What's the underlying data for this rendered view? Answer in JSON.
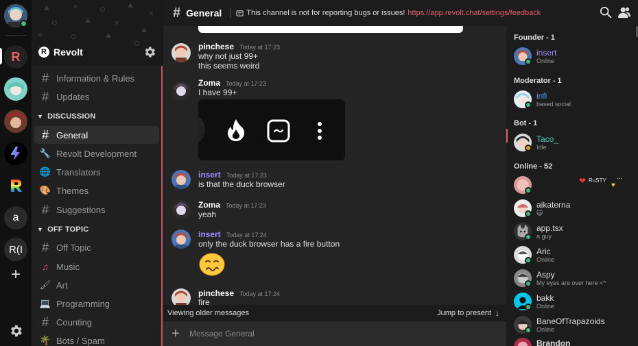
{
  "servers": {
    "home_label": "",
    "revolt_initial": "R",
    "letter_a": "a",
    "letter_ri": "R(I",
    "add_label": "+"
  },
  "server": {
    "name": "Revolt",
    "logo_letter": "R"
  },
  "channels": {
    "top": [
      {
        "label": "Information & Rules",
        "icon": "hash-icon"
      },
      {
        "label": "Updates",
        "icon": "hash-icon"
      }
    ],
    "cat_discussion": "DISCUSSION",
    "discussion": [
      {
        "label": "General",
        "icon": "hash-icon"
      },
      {
        "label": "Revolt Development",
        "icon": "wrench-icon"
      },
      {
        "label": "Translators",
        "icon": "globe-icon"
      },
      {
        "label": "Themes",
        "icon": "palette-icon"
      },
      {
        "label": "Suggestions",
        "icon": "hash-icon"
      }
    ],
    "cat_offtopic": "OFF TOPIC",
    "offtopic": [
      {
        "label": "Off Topic",
        "icon": "hash-icon"
      },
      {
        "label": "Music",
        "icon": "music-note-icon"
      },
      {
        "label": "Art",
        "icon": "paintbrush-icon"
      },
      {
        "label": "Programming",
        "icon": "laptop-icon"
      },
      {
        "label": "Counting",
        "icon": "hash-icon"
      },
      {
        "label": "Bots / Spam",
        "icon": "palm-tree-icon"
      }
    ]
  },
  "header": {
    "hash": "#",
    "title": "General",
    "topic_text": "This channel is not for reporting bugs or issues!",
    "topic_link": "https://app.revolt.chat/settings/feedback"
  },
  "messages": [
    {
      "author": "pinchese",
      "time": "Today at 17:23",
      "lines": [
        "why not just 99+",
        "this seems weird"
      ]
    },
    {
      "author": "Zoma",
      "time": "Today at 17:23",
      "lines": [
        "I have 99+"
      ]
    },
    {
      "author": "insert",
      "time": "Today at 17:23",
      "lines": [
        "is that the duck browser"
      ]
    },
    {
      "author": "Zoma",
      "time": "Today at 17:23",
      "lines": [
        "yeah"
      ]
    },
    {
      "author": "insert",
      "time": "Today at 17:24",
      "lines": [
        "only the duck browser has a fire button"
      ]
    },
    {
      "author": "pinchese",
      "time": "Today at 17:24",
      "lines": [
        "fire"
      ]
    }
  ],
  "older_bar": {
    "label": "Viewing older messages",
    "jump": "Jump to present"
  },
  "composer": {
    "placeholder": "Message General",
    "plus": "+"
  },
  "members": {
    "founder_label": "Founder - 1",
    "moderator_label": "Moderator - 1",
    "bot_label": "Bot - 1",
    "online_label": "Online - 52",
    "founder": {
      "name": "insert",
      "status": "Online"
    },
    "moderator": {
      "name": "infi",
      "status": "based.social"
    },
    "bot": {
      "name": "Taco_",
      "status": "Idle"
    },
    "online": [
      {
        "name": "",
        "status": ""
      },
      {
        "name": "aikaterna",
        "status": "😺"
      },
      {
        "name": "app.tsx",
        "status": "a guy"
      },
      {
        "name": "Aric",
        "status": "Online"
      },
      {
        "name": "Aspy",
        "status": "My eyes are over here <^"
      },
      {
        "name": "bakk",
        "status": "Online"
      },
      {
        "name": "BaneOfTrapazoids",
        "status": "Online"
      },
      {
        "name": "Brandon",
        "status": ""
      }
    ],
    "rusty_text": "RuSTY",
    "more": "..."
  },
  "colors": {
    "accent": "#e9606e",
    "online": "#3abf7e",
    "idle": "#f39f00",
    "purple_name": "#a38bff",
    "teal_name": "#3ed2b7",
    "blue_name": "#4e9bf5"
  }
}
